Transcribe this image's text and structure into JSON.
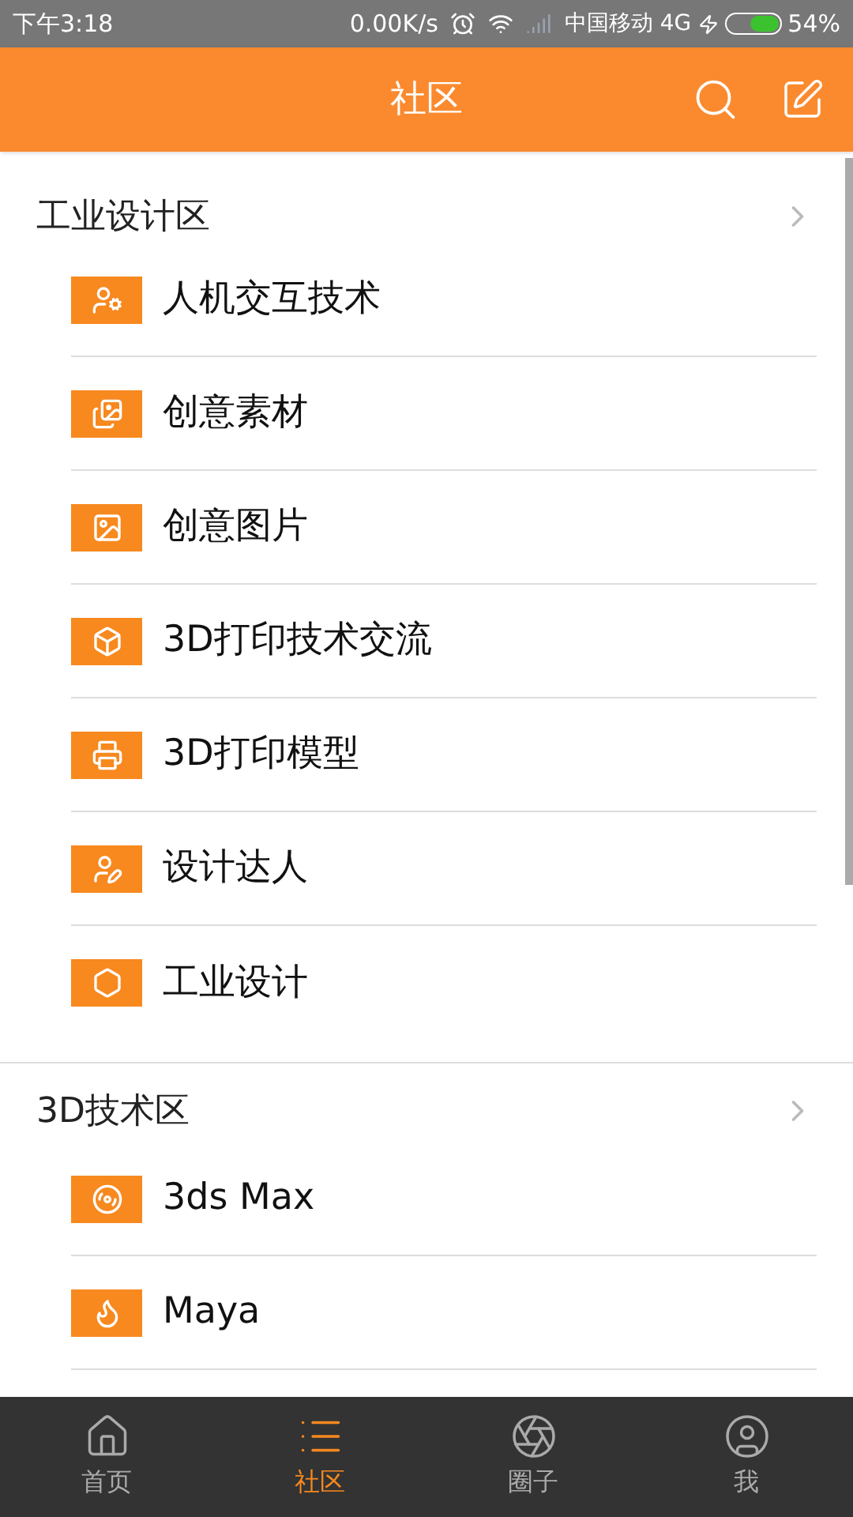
{
  "status_bar": {
    "time": "下午3:18",
    "speed": "0.00K/s",
    "carrier": "中国移动 4G",
    "battery": "54%"
  },
  "header": {
    "title": "社区"
  },
  "sections": [
    {
      "title": "工业设计区",
      "items": [
        {
          "label": "人机交互技术"
        },
        {
          "label": "创意素材"
        },
        {
          "label": "创意图片"
        },
        {
          "label": "3D打印技术交流"
        },
        {
          "label": "3D打印模型"
        },
        {
          "label": "设计达人"
        },
        {
          "label": "工业设计"
        }
      ]
    },
    {
      "title": "3D技术区",
      "items": [
        {
          "label": "3ds Max"
        },
        {
          "label": "Maya"
        }
      ]
    }
  ],
  "tabs": [
    {
      "label": "首页",
      "selected": false
    },
    {
      "label": "社区",
      "selected": true
    },
    {
      "label": "圈子",
      "selected": false
    },
    {
      "label": "我",
      "selected": false
    }
  ]
}
